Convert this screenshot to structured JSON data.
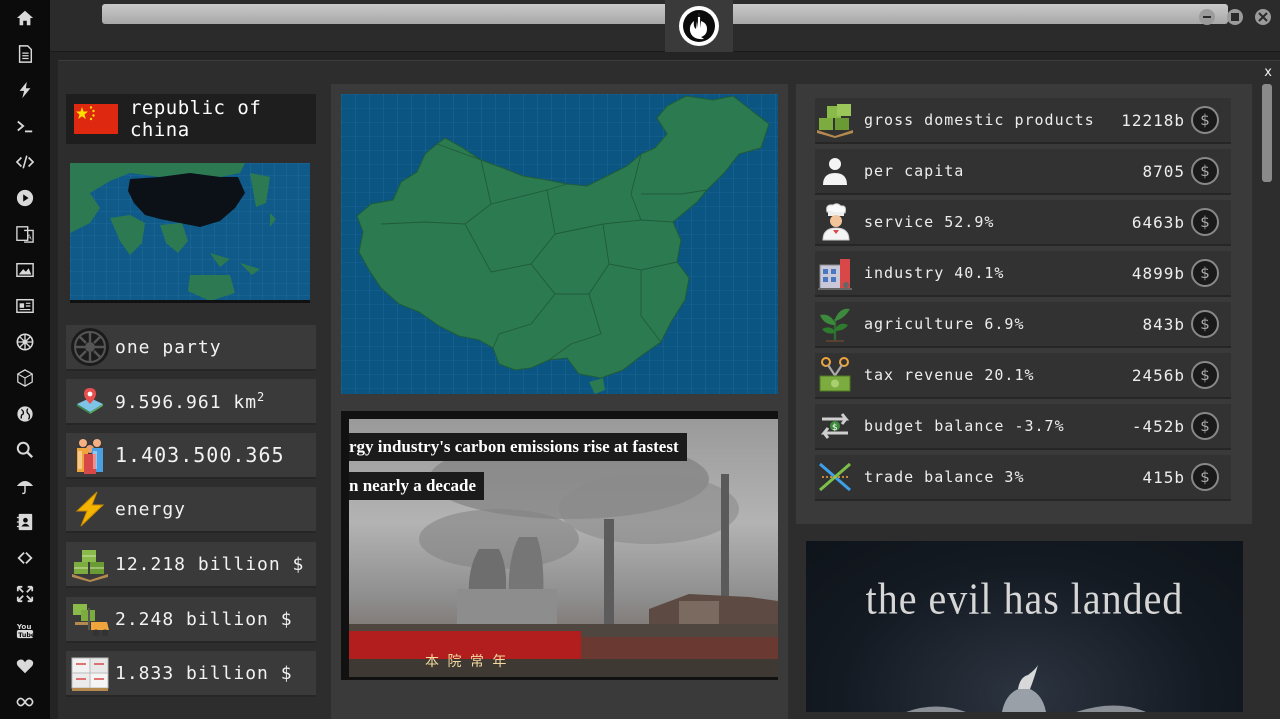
{
  "window": {
    "logo_icon": "rebel-alliance-icon",
    "buttons": [
      "minimize-icon",
      "maximize-icon",
      "close-icon"
    ]
  },
  "sidebar": {
    "icons": [
      "home-icon",
      "document-icon",
      "bolt-icon",
      "terminal-icon",
      "code-icon",
      "play-icon",
      "translate-icon",
      "image-icon",
      "news-icon",
      "empire-icon",
      "cube-icon",
      "globe-icon",
      "search-icon",
      "umbrella-icon",
      "contacts-icon",
      "links-icon",
      "expand-icon",
      "youtube-icon",
      "heart-icon",
      "infinity-icon"
    ]
  },
  "panel": {
    "close_label": "x"
  },
  "country": {
    "name": "republic of china",
    "flag_colors": {
      "red": "#de2910",
      "star": "#ffde00"
    }
  },
  "facts": {
    "government": "one party",
    "area": "9.596.961 km",
    "area_sup": "2",
    "population": "1.403.500.365",
    "resource": "energy",
    "gdp": "12.218 billion $",
    "exports": "2.248 billion $",
    "imports": "1.833 billion $"
  },
  "news": {
    "line1": "rgy industry's carbon emissions rise at fastest",
    "line2": "n nearly a decade",
    "banner_text": "本 院 常 年"
  },
  "economy": {
    "rows": [
      {
        "label": "gross domestic products",
        "value": "12218b",
        "icon": "money-stack-icon"
      },
      {
        "label": "per capita",
        "value": "8705",
        "icon": "person-icon"
      },
      {
        "label": "service 52.9%",
        "value": "6463b",
        "icon": "chef-icon"
      },
      {
        "label": "industry 40.1%",
        "value": "4899b",
        "icon": "factory-icon"
      },
      {
        "label": "agriculture 6.9%",
        "value": "843b",
        "icon": "sprout-icon"
      },
      {
        "label": "tax revenue 20.1%",
        "value": "2456b",
        "icon": "tax-scissors-icon"
      },
      {
        "label": "budget balance -3.7%",
        "value": "-452b",
        "icon": "budget-arrows-icon"
      },
      {
        "label": "trade balance 3%",
        "value": "415b",
        "icon": "trade-cross-icon"
      }
    ],
    "coin_symbol": "$"
  },
  "poster": {
    "title": "the evil has landed"
  }
}
